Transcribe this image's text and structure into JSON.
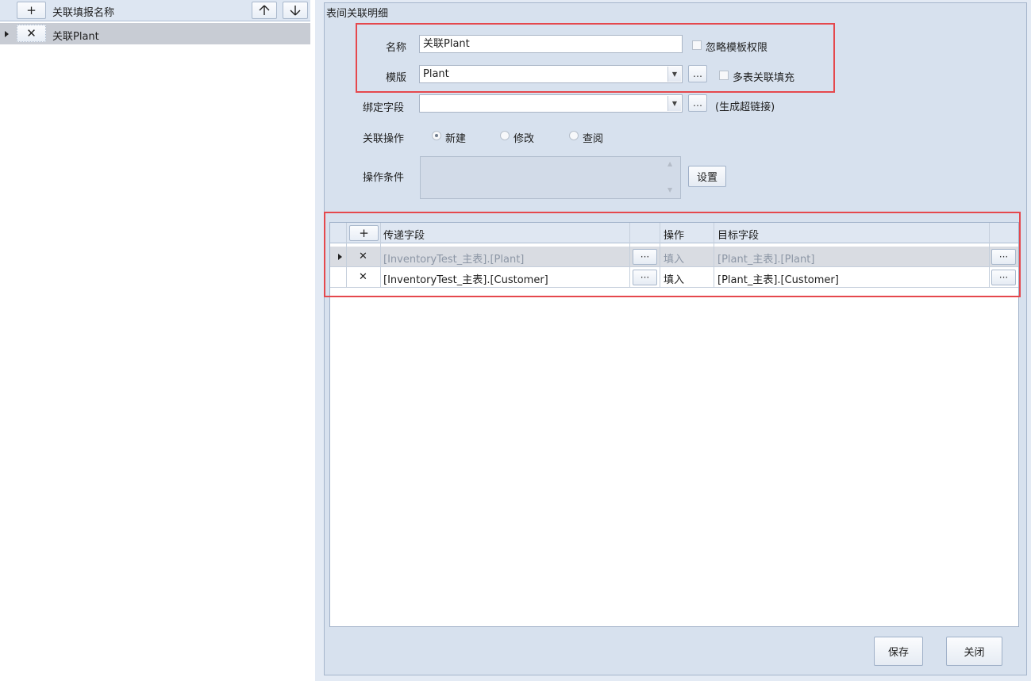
{
  "left_list": {
    "add_label": "+",
    "column_header": "关联填报名称",
    "up_label": "↑",
    "down_label": "↓",
    "items": [
      {
        "delete_label": "✕",
        "name": "关联Plant"
      }
    ]
  },
  "detail": {
    "group_title": "表间关联明细",
    "name_label": "名称",
    "name_value": "关联Plant",
    "ignore_permission_label": "忽略模板权限",
    "template_label": "模版",
    "template_value": "Plant",
    "ellipsis": "…",
    "multi_table_label": "多表关联填充",
    "bind_field_label": "绑定字段",
    "bind_field_value": "",
    "hyperlink_hint": "(生成超链接)",
    "operation_label": "关联操作",
    "operation_options": [
      "新建",
      "修改",
      "查阅"
    ],
    "operation_selected": "新建",
    "condition_label": "操作条件",
    "settings_button": "设置"
  },
  "grid": {
    "add_label": "+",
    "columns": [
      "传递字段",
      "操作",
      "目标字段"
    ],
    "cell_button": "···",
    "rows": [
      {
        "delete": "✕",
        "source": "[InventoryTest_主表].[Plant]",
        "op": "填入",
        "target": "[Plant_主表].[Plant]"
      },
      {
        "delete": "✕",
        "source": "[InventoryTest_主表].[Customer]",
        "op": "填入",
        "target": "[Plant_主表].[Customer]"
      }
    ]
  },
  "footer": {
    "save_label": "保存",
    "close_label": "关闭"
  },
  "colors": {
    "panel_bg": "#d7e1ee",
    "highlight": "#e5484d",
    "selected_row": "#c8ccd4"
  }
}
